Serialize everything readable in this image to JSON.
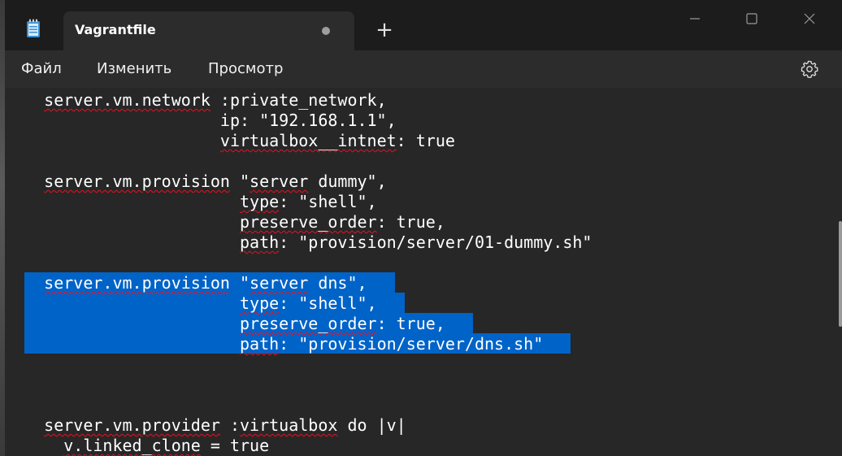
{
  "tab": {
    "title": "Vagrantfile",
    "new_tab_label": "+"
  },
  "menu": {
    "file": "Файл",
    "edit": "Изменить",
    "view": "Просмотр"
  },
  "icons": {
    "app": "notepad-icon",
    "unsaved": "unsaved-dot-icon",
    "new_tab": "plus-icon",
    "minimize": "minimize-icon",
    "maximize": "maximize-icon",
    "close": "close-icon",
    "settings": "gear-icon"
  },
  "colors": {
    "selection": "#0063c8",
    "spell_squiggle": "#e81123"
  },
  "editor": {
    "lines": [
      "    server.vm.network :private_network,",
      "                      ip: \"192.168.1.1\",",
      "                      virtualbox__intnet: true",
      "",
      "    server.vm.provision \"server dummy\",",
      "                        type: \"shell\",",
      "                        preserve_order: true,",
      "                        path: \"provision/server/01-dummy.sh\"",
      "",
      "    server.vm.provision \"server dns\",",
      "                        type: \"shell\",",
      "                        preserve_order: true,",
      "                        path: \"provision/server/dns.sh\"",
      "",
      "",
      "",
      "    server.vm.provider :virtualbox do |v|",
      "      v.linked_clone = true"
    ],
    "selected_lines": [
      9,
      10,
      11,
      12
    ]
  }
}
